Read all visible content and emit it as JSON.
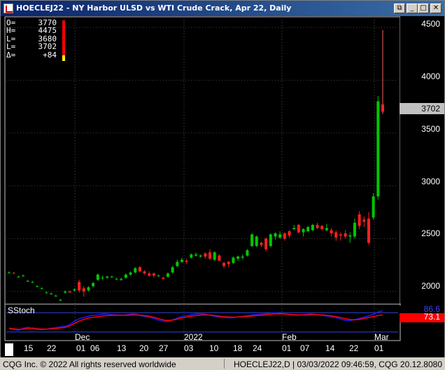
{
  "window": {
    "title": "HOECLEJ22 - NY Harbor ULSD vs WTI Crude Crack, Apr 22, Daily",
    "buttons": [
      "restore",
      "minimize",
      "maximize",
      "close"
    ]
  },
  "ohlc": [
    {
      "label": "O=",
      "value": "3770"
    },
    {
      "label": "H=",
      "value": "4475"
    },
    {
      "label": "L=",
      "value": "3680"
    },
    {
      "label": "L=",
      "value": "3702"
    },
    {
      "label": "Δ=",
      "value": "+84"
    }
  ],
  "price_axis": {
    "ticks": [
      "4500",
      "4000",
      "3500",
      "3000",
      "2500",
      "2000"
    ],
    "current_price": "3702"
  },
  "stoch": {
    "label": "SStoch",
    "k_value": "86.6",
    "d_value": "73.1",
    "k_color": "#1a1aff",
    "d_color": "#ff0000"
  },
  "date_axis": {
    "months": [
      "Dec",
      "2022",
      "Feb",
      "Mar"
    ],
    "days": [
      "15",
      "22",
      "01",
      "06",
      "13",
      "20",
      "27",
      "03",
      "10",
      "18",
      "24",
      "01",
      "07",
      "14",
      "22",
      "01"
    ]
  },
  "chart_data": {
    "type": "candlestick",
    "title": "HOECLEJ22 - NY Harbor ULSD vs WTI Crude Crack, Apr 22, Daily",
    "ylim": [
      1880,
      4600
    ],
    "candles": [
      {
        "o": 2180,
        "h": 2190,
        "l": 2170,
        "c": 2180
      },
      {
        "o": 2175,
        "h": 2185,
        "l": 2165,
        "c": 2170
      },
      {
        "o": 2140,
        "h": 2150,
        "l": 2130,
        "c": 2140
      },
      {
        "o": 2150,
        "h": 2160,
        "l": 2140,
        "c": 2150
      },
      {
        "o": 2100,
        "h": 2110,
        "l": 2090,
        "c": 2100
      },
      {
        "o": 2090,
        "h": 2100,
        "l": 2080,
        "c": 2090
      },
      {
        "o": 2050,
        "h": 2060,
        "l": 2040,
        "c": 2050
      },
      {
        "o": 2030,
        "h": 2040,
        "l": 2020,
        "c": 2030
      },
      {
        "o": 1990,
        "h": 2000,
        "l": 1980,
        "c": 1990
      },
      {
        "o": 1980,
        "h": 1990,
        "l": 1970,
        "c": 1980
      },
      {
        "o": 1960,
        "h": 1970,
        "l": 1950,
        "c": 1960
      },
      {
        "o": 1920,
        "h": 1930,
        "l": 1910,
        "c": 1920
      },
      {
        "o": 1990,
        "h": 2010,
        "l": 1980,
        "c": 2000
      },
      {
        "o": 2000,
        "h": 2010,
        "l": 1990,
        "c": 1990
      },
      {
        "o": 2010,
        "h": 2030,
        "l": 2000,
        "c": 2020
      },
      {
        "o": 2090,
        "h": 2110,
        "l": 1990,
        "c": 2010
      },
      {
        "o": 2030,
        "h": 2050,
        "l": 1950,
        "c": 2000
      },
      {
        "o": 2010,
        "h": 2050,
        "l": 2000,
        "c": 2040
      },
      {
        "o": 2050,
        "h": 2090,
        "l": 2040,
        "c": 2080
      },
      {
        "o": 2110,
        "h": 2170,
        "l": 2100,
        "c": 2160
      },
      {
        "o": 2130,
        "h": 2150,
        "l": 2110,
        "c": 2130
      },
      {
        "o": 2130,
        "h": 2150,
        "l": 2120,
        "c": 2140
      },
      {
        "o": 2140,
        "h": 2150,
        "l": 2130,
        "c": 2140
      },
      {
        "o": 2120,
        "h": 2130,
        "l": 2110,
        "c": 2120
      },
      {
        "o": 2110,
        "h": 2130,
        "l": 2100,
        "c": 2120
      },
      {
        "o": 2130,
        "h": 2170,
        "l": 2120,
        "c": 2160
      },
      {
        "o": 2160,
        "h": 2190,
        "l": 2150,
        "c": 2180
      },
      {
        "o": 2180,
        "h": 2230,
        "l": 2170,
        "c": 2220
      },
      {
        "o": 2230,
        "h": 2240,
        "l": 2180,
        "c": 2190
      },
      {
        "o": 2190,
        "h": 2200,
        "l": 2160,
        "c": 2170
      },
      {
        "o": 2170,
        "h": 2190,
        "l": 2140,
        "c": 2150
      },
      {
        "o": 2170,
        "h": 2180,
        "l": 2130,
        "c": 2150
      },
      {
        "o": 2150,
        "h": 2160,
        "l": 2140,
        "c": 2150
      },
      {
        "o": 2130,
        "h": 2140,
        "l": 2110,
        "c": 2120
      },
      {
        "o": 2140,
        "h": 2180,
        "l": 2130,
        "c": 2170
      },
      {
        "o": 2180,
        "h": 2240,
        "l": 2170,
        "c": 2230
      },
      {
        "o": 2240,
        "h": 2300,
        "l": 2230,
        "c": 2280
      },
      {
        "o": 2280,
        "h": 2320,
        "l": 2270,
        "c": 2300
      },
      {
        "o": 2290,
        "h": 2310,
        "l": 2260,
        "c": 2280
      },
      {
        "o": 2320,
        "h": 2360,
        "l": 2310,
        "c": 2350
      },
      {
        "o": 2340,
        "h": 2370,
        "l": 2330,
        "c": 2350
      },
      {
        "o": 2330,
        "h": 2350,
        "l": 2320,
        "c": 2340
      },
      {
        "o": 2360,
        "h": 2370,
        "l": 2310,
        "c": 2330
      },
      {
        "o": 2370,
        "h": 2400,
        "l": 2300,
        "c": 2310
      },
      {
        "o": 2300,
        "h": 2380,
        "l": 2290,
        "c": 2370
      },
      {
        "o": 2340,
        "h": 2350,
        "l": 2290,
        "c": 2290
      },
      {
        "o": 2270,
        "h": 2280,
        "l": 2220,
        "c": 2240
      },
      {
        "o": 2280,
        "h": 2290,
        "l": 2230,
        "c": 2260
      },
      {
        "o": 2270,
        "h": 2330,
        "l": 2260,
        "c": 2320
      },
      {
        "o": 2310,
        "h": 2340,
        "l": 2290,
        "c": 2330
      },
      {
        "o": 2320,
        "h": 2350,
        "l": 2300,
        "c": 2330
      },
      {
        "o": 2340,
        "h": 2400,
        "l": 2330,
        "c": 2390
      },
      {
        "o": 2430,
        "h": 2550,
        "l": 2420,
        "c": 2540
      },
      {
        "o": 2430,
        "h": 2530,
        "l": 2420,
        "c": 2520
      },
      {
        "o": 2460,
        "h": 2470,
        "l": 2420,
        "c": 2440
      },
      {
        "o": 2500,
        "h": 2510,
        "l": 2380,
        "c": 2400
      },
      {
        "o": 2430,
        "h": 2550,
        "l": 2420,
        "c": 2540
      },
      {
        "o": 2520,
        "h": 2560,
        "l": 2490,
        "c": 2550
      },
      {
        "o": 2510,
        "h": 2570,
        "l": 2500,
        "c": 2540
      },
      {
        "o": 2550,
        "h": 2560,
        "l": 2480,
        "c": 2500
      },
      {
        "o": 2570,
        "h": 2580,
        "l": 2510,
        "c": 2530
      },
      {
        "o": 2590,
        "h": 2630,
        "l": 2580,
        "c": 2600
      },
      {
        "o": 2630,
        "h": 2640,
        "l": 2550,
        "c": 2560
      },
      {
        "o": 2560,
        "h": 2600,
        "l": 2520,
        "c": 2590
      },
      {
        "o": 2570,
        "h": 2620,
        "l": 2560,
        "c": 2610
      },
      {
        "o": 2580,
        "h": 2640,
        "l": 2570,
        "c": 2630
      },
      {
        "o": 2630,
        "h": 2650,
        "l": 2590,
        "c": 2600
      },
      {
        "o": 2620,
        "h": 2630,
        "l": 2580,
        "c": 2590
      },
      {
        "o": 2580,
        "h": 2640,
        "l": 2570,
        "c": 2600
      },
      {
        "o": 2580,
        "h": 2600,
        "l": 2520,
        "c": 2550
      },
      {
        "o": 2560,
        "h": 2580,
        "l": 2480,
        "c": 2510
      },
      {
        "o": 2540,
        "h": 2560,
        "l": 2480,
        "c": 2530
      },
      {
        "o": 2550,
        "h": 2580,
        "l": 2500,
        "c": 2520
      },
      {
        "o": 2520,
        "h": 2560,
        "l": 2460,
        "c": 2530
      },
      {
        "o": 2520,
        "h": 2690,
        "l": 2500,
        "c": 2650
      },
      {
        "o": 2730,
        "h": 2760,
        "l": 2590,
        "c": 2620
      },
      {
        "o": 2680,
        "h": 2710,
        "l": 2610,
        "c": 2660
      },
      {
        "o": 2690,
        "h": 2750,
        "l": 2440,
        "c": 2460
      },
      {
        "o": 2700,
        "h": 2930,
        "l": 2680,
        "c": 2900
      },
      {
        "o": 2900,
        "h": 3850,
        "l": 2870,
        "c": 3800
      },
      {
        "o": 3770,
        "h": 4475,
        "l": 3680,
        "c": 3702
      }
    ],
    "stoch_k": [
      30,
      28,
      25,
      32,
      35,
      30,
      28,
      27,
      29,
      32,
      34,
      36,
      38,
      45,
      55,
      62,
      66,
      70,
      72,
      74,
      76,
      75,
      74,
      73,
      72,
      74,
      76,
      75,
      70,
      68,
      65,
      60,
      55,
      52,
      55,
      60,
      66,
      70,
      72,
      75,
      77,
      76,
      74,
      70,
      68,
      66,
      65,
      64,
      66,
      68,
      70,
      72,
      74,
      75,
      76,
      78,
      80,
      78,
      76,
      74,
      73,
      72,
      74,
      75,
      76,
      74,
      72,
      70,
      68,
      66,
      60,
      57,
      55,
      58,
      62,
      66,
      70,
      75,
      82,
      86
    ],
    "stoch_d": [
      32,
      30,
      28,
      29,
      31,
      32,
      30,
      29,
      29,
      30,
      31,
      33,
      35,
      40,
      48,
      55,
      60,
      64,
      66,
      68,
      70,
      71,
      72,
      72,
      72,
      72,
      73,
      73,
      72,
      70,
      68,
      64,
      60,
      56,
      56,
      58,
      62,
      65,
      68,
      70,
      72,
      73,
      73,
      72,
      70,
      68,
      67,
      66,
      66,
      67,
      68,
      69,
      71,
      72,
      73,
      74,
      76,
      76,
      76,
      75,
      74,
      73,
      73,
      73,
      74,
      74,
      73,
      72,
      70,
      68,
      65,
      62,
      59,
      58,
      59,
      62,
      65,
      68,
      71,
      73
    ]
  }
}
